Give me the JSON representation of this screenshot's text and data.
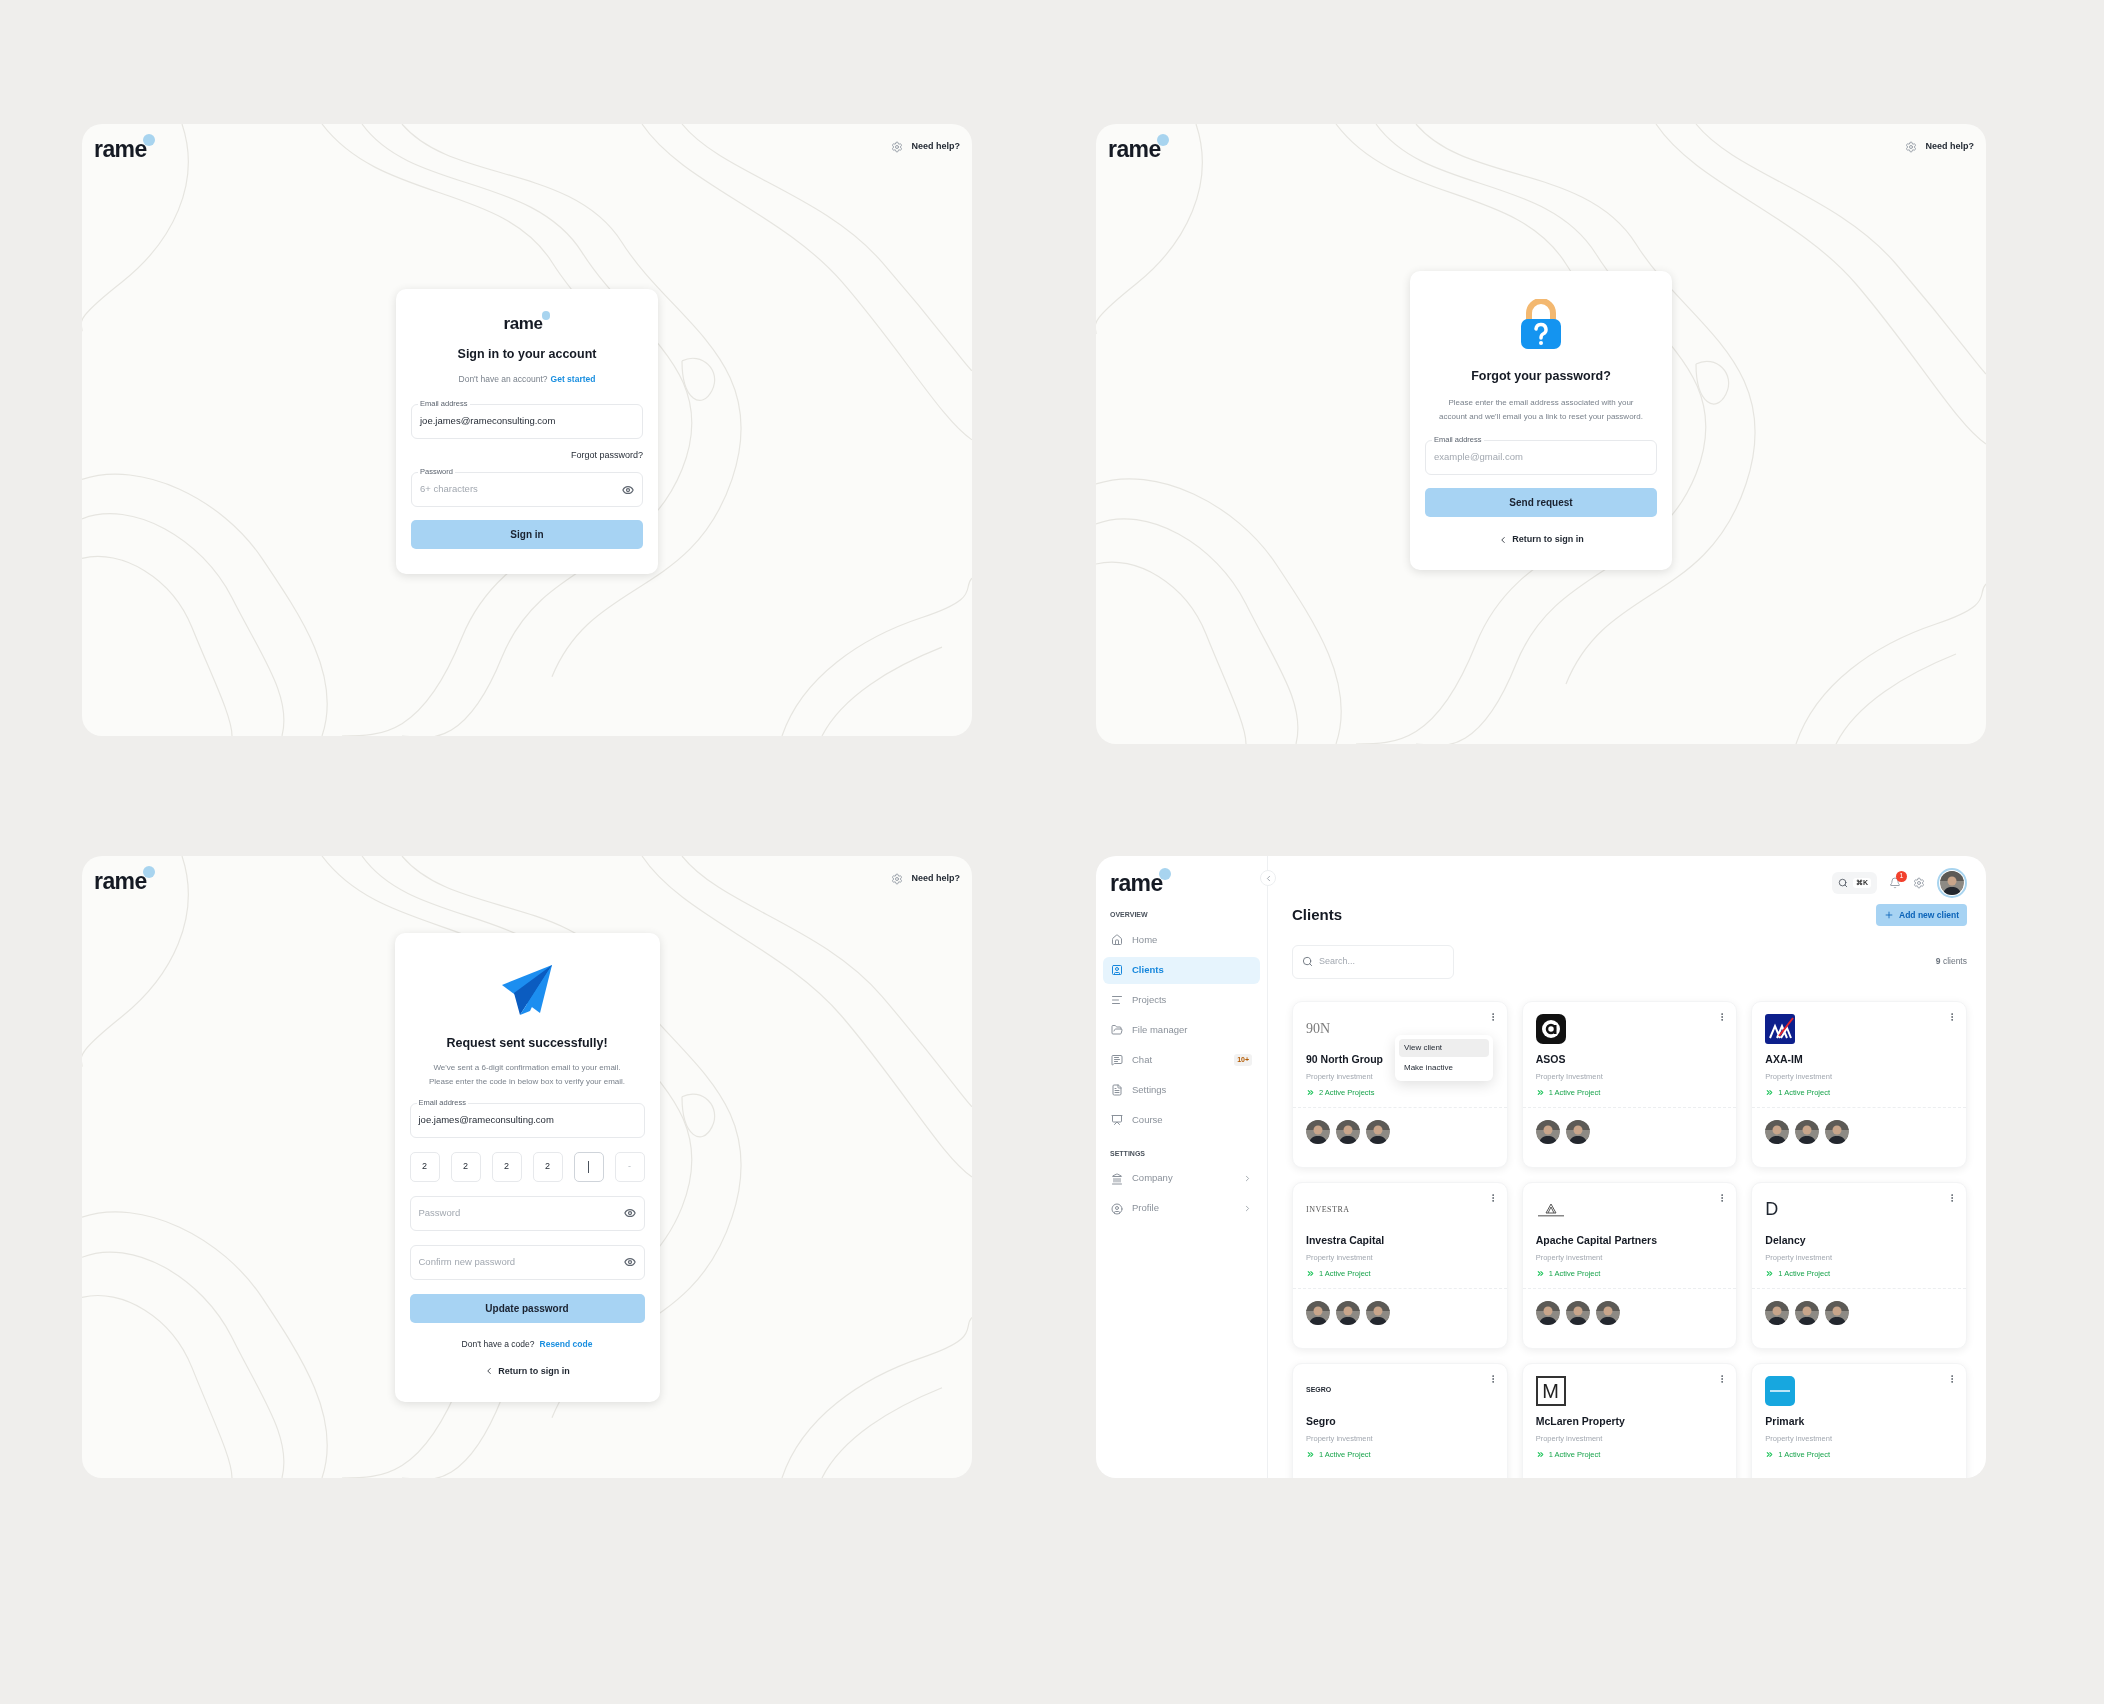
{
  "sign_in_screen": {
    "logo": "rame",
    "help": "Need help?",
    "card_logo": "rame",
    "title": "Sign in to your account",
    "prompt": "Don't have an account?",
    "prompt_link": "Get started",
    "email": {
      "label": "Email address",
      "value": "joe.james@rameconsulting.com"
    },
    "forgot_link": "Forgot password?",
    "password": {
      "label": "Password",
      "placeholder": "6+ characters"
    },
    "button": "Sign in"
  },
  "forgot_password_screen": {
    "logo": "rame",
    "help": "Need help?",
    "title": "Forgot your password?",
    "description_lines": [
      "Please enter the email address associated with your",
      "account and we'll email you a link to reset your password."
    ],
    "email": {
      "label": "Email address",
      "placeholder": "example@gmail.com"
    },
    "button": "Send request",
    "back_link": "Return to sign in"
  },
  "reset_screen": {
    "logo": "rame",
    "help": "Need help?",
    "title": "Request sent successfully!",
    "description_lines": [
      "We've sent a 6-digit confirmation email to your email.",
      "Please enter the code in below box to verify your email."
    ],
    "email": {
      "label": "Email address",
      "value": "joe.james@rameconsulting.com"
    },
    "code_boxes": [
      {
        "value": "2",
        "active": false
      },
      {
        "value": "2",
        "active": false
      },
      {
        "value": "2",
        "active": false
      },
      {
        "value": "2",
        "active": false
      },
      {
        "active": true
      },
      {
        "placeholder": "-",
        "active": false
      }
    ],
    "password": {
      "placeholder": "Password"
    },
    "confirm": {
      "placeholder": "Confirm new password"
    },
    "button": "Update password",
    "prompt": "Don't have a code?",
    "prompt_link": "Resend code",
    "back_link": "Return to sign in"
  },
  "clients_screen": {
    "logo": "rame",
    "sidebar": {
      "sections": [
        {
          "heading": "OVERVIEW",
          "items": [
            {
              "label": "Home",
              "selected": false
            },
            {
              "label": "Clients",
              "selected": true
            },
            {
              "label": "Projects",
              "selected": false
            },
            {
              "label": "File manager",
              "selected": false
            },
            {
              "label": "Chat",
              "selected": false,
              "badge": "10+"
            },
            {
              "label": "Settings",
              "selected": false
            },
            {
              "label": "Course",
              "selected": false
            }
          ]
        },
        {
          "heading": "SETTINGS",
          "items": [
            {
              "label": "Company",
              "selected": false,
              "chevron": true
            },
            {
              "label": "Profile",
              "selected": false,
              "chevron": true
            }
          ]
        }
      ]
    },
    "search_shortcut": "⌘K",
    "notification_count": "1",
    "title": "Clients",
    "add_button": "Add new client",
    "search_placeholder": "Search...",
    "count": "**9** clients",
    "clients": [
      {
        "name": "90 North Group",
        "category": "Property investment",
        "projects": "2 Active Projects",
        "logo": {
          "kind": "serif",
          "text": "90N"
        },
        "members": [
          {
            "kind": "picture"
          },
          {
            "kind": "picture"
          },
          {
            "kind": "picture"
          }
        ],
        "menu": [
          {
            "label": "View client",
            "selected": true
          },
          {
            "label": "Make inactive",
            "selected": false
          }
        ]
      },
      {
        "name": "ASOS",
        "category": "Property Investment",
        "projects": "1 Active Project",
        "logo": {
          "kind": "asos"
        },
        "members": [
          {
            "kind": "picture"
          },
          {
            "kind": "picture"
          }
        ]
      },
      {
        "name": "AXA-IM",
        "category": "Property investment",
        "projects": "1 Active Project",
        "logo": {
          "kind": "axa"
        },
        "members": [
          {
            "kind": "picture"
          },
          {
            "kind": "picture"
          },
          {
            "kind": "picture"
          }
        ]
      },
      {
        "name": "Investra Capital",
        "category": "Property investment",
        "projects": "1 Active Project",
        "logo": {
          "kind": "small_serif",
          "text": "INVESTRA"
        },
        "members": [
          {
            "kind": "picture"
          },
          {
            "kind": "picture"
          },
          {
            "kind": "picture"
          }
        ]
      },
      {
        "name": "Apache Capital Partners",
        "category": "Property investment",
        "projects": "1 Active Project",
        "logo": {
          "kind": "apache"
        },
        "members": [
          {
            "kind": "picture"
          },
          {
            "kind": "picture"
          },
          {
            "kind": "picture"
          }
        ]
      },
      {
        "name": "Delancy",
        "category": "Property investment",
        "projects": "1 Active Project",
        "logo": {
          "kind": "letter",
          "text": "D"
        },
        "members": [
          {
            "kind": "picture"
          },
          {
            "kind": "picture"
          },
          {
            "kind": "picture"
          }
        ]
      },
      {
        "name": "Segro",
        "category": "Property investment",
        "projects": "1 Active Project",
        "logo": {
          "kind": "bold",
          "text": "SEGRO"
        }
      },
      {
        "name": "McLaren Property",
        "category": "Property investment",
        "projects": "1 Active Project",
        "logo": {
          "kind": "boxed",
          "text": "M"
        }
      },
      {
        "name": "Primark",
        "category": "Property investment",
        "projects": "1 Active Project",
        "logo": {
          "kind": "primark"
        }
      }
    ]
  }
}
